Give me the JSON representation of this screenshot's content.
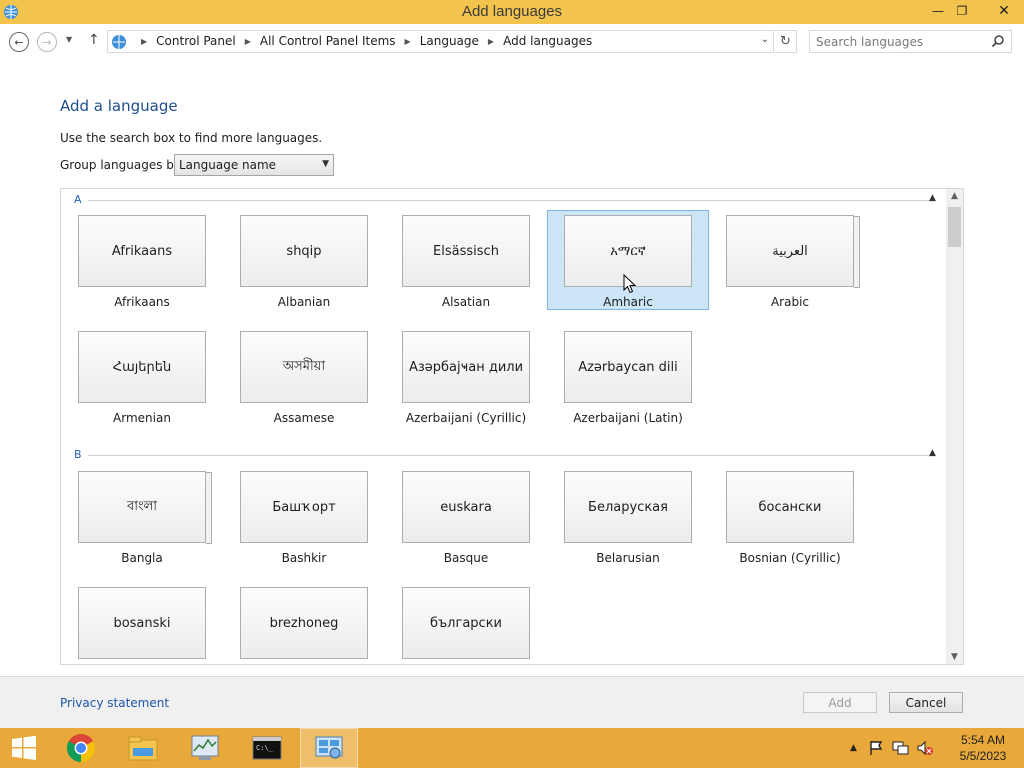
{
  "window": {
    "title": "Add languages",
    "minimize": "—",
    "maximize": "❐",
    "close": "✕"
  },
  "nav": {
    "breadcrumbs": [
      "Control Panel",
      "All Control Panel Items",
      "Language",
      "Add languages"
    ],
    "search_placeholder": "Search languages"
  },
  "page": {
    "heading": "Add a language",
    "hint": "Use the search box to find more languages.",
    "group_by_label": "Group languages by:",
    "group_by_value": "Language name"
  },
  "groups": [
    {
      "letter": "A",
      "languages": [
        {
          "native": "Afrikaans",
          "name": "Afrikaans",
          "stacked": false,
          "selected": false
        },
        {
          "native": "shqip",
          "name": "Albanian",
          "stacked": false,
          "selected": false
        },
        {
          "native": "Elsässisch",
          "name": "Alsatian",
          "stacked": false,
          "selected": false
        },
        {
          "native": "አማርኛ",
          "name": "Amharic",
          "stacked": false,
          "selected": true
        },
        {
          "native": "العربية",
          "name": "Arabic",
          "stacked": true,
          "selected": false
        },
        {
          "native": "Հայերեն",
          "name": "Armenian",
          "stacked": false,
          "selected": false
        },
        {
          "native": "অসমীয়া",
          "name": "Assamese",
          "stacked": false,
          "selected": false
        },
        {
          "native": "Азәрбајҹан дили",
          "name": "Azerbaijani (Cyrillic)",
          "stacked": false,
          "selected": false
        },
        {
          "native": "Azərbaycan dili",
          "name": "Azerbaijani (Latin)",
          "stacked": false,
          "selected": false
        }
      ]
    },
    {
      "letter": "B",
      "languages": [
        {
          "native": "বাংলা",
          "name": "Bangla",
          "stacked": true,
          "selected": false
        },
        {
          "native": "Башҡорт",
          "name": "Bashkir",
          "stacked": false,
          "selected": false
        },
        {
          "native": "euskara",
          "name": "Basque",
          "stacked": false,
          "selected": false
        },
        {
          "native": "Беларуская",
          "name": "Belarusian",
          "stacked": false,
          "selected": false
        },
        {
          "native": "босански",
          "name": "Bosnian (Cyrillic)",
          "stacked": false,
          "selected": false
        },
        {
          "native": "bosanski",
          "name": "",
          "stacked": false,
          "selected": false
        },
        {
          "native": "brezhoneg",
          "name": "",
          "stacked": false,
          "selected": false
        },
        {
          "native": "български",
          "name": "",
          "stacked": false,
          "selected": false
        }
      ]
    }
  ],
  "footer": {
    "privacy": "Privacy statement",
    "add": "Add",
    "cancel": "Cancel"
  },
  "taskbar": {
    "items": [
      "start-icon",
      "chrome-icon",
      "file-explorer-icon",
      "performance-monitor-icon",
      "command-prompt-icon",
      "control-panel-icon"
    ],
    "time": "5:54 AM",
    "date": "5/5/2023"
  },
  "colors": {
    "titlebar": "#f2c34d",
    "taskbar": "#e8a93a",
    "heading": "#1e4e8c",
    "selection": "#cde6f7"
  }
}
